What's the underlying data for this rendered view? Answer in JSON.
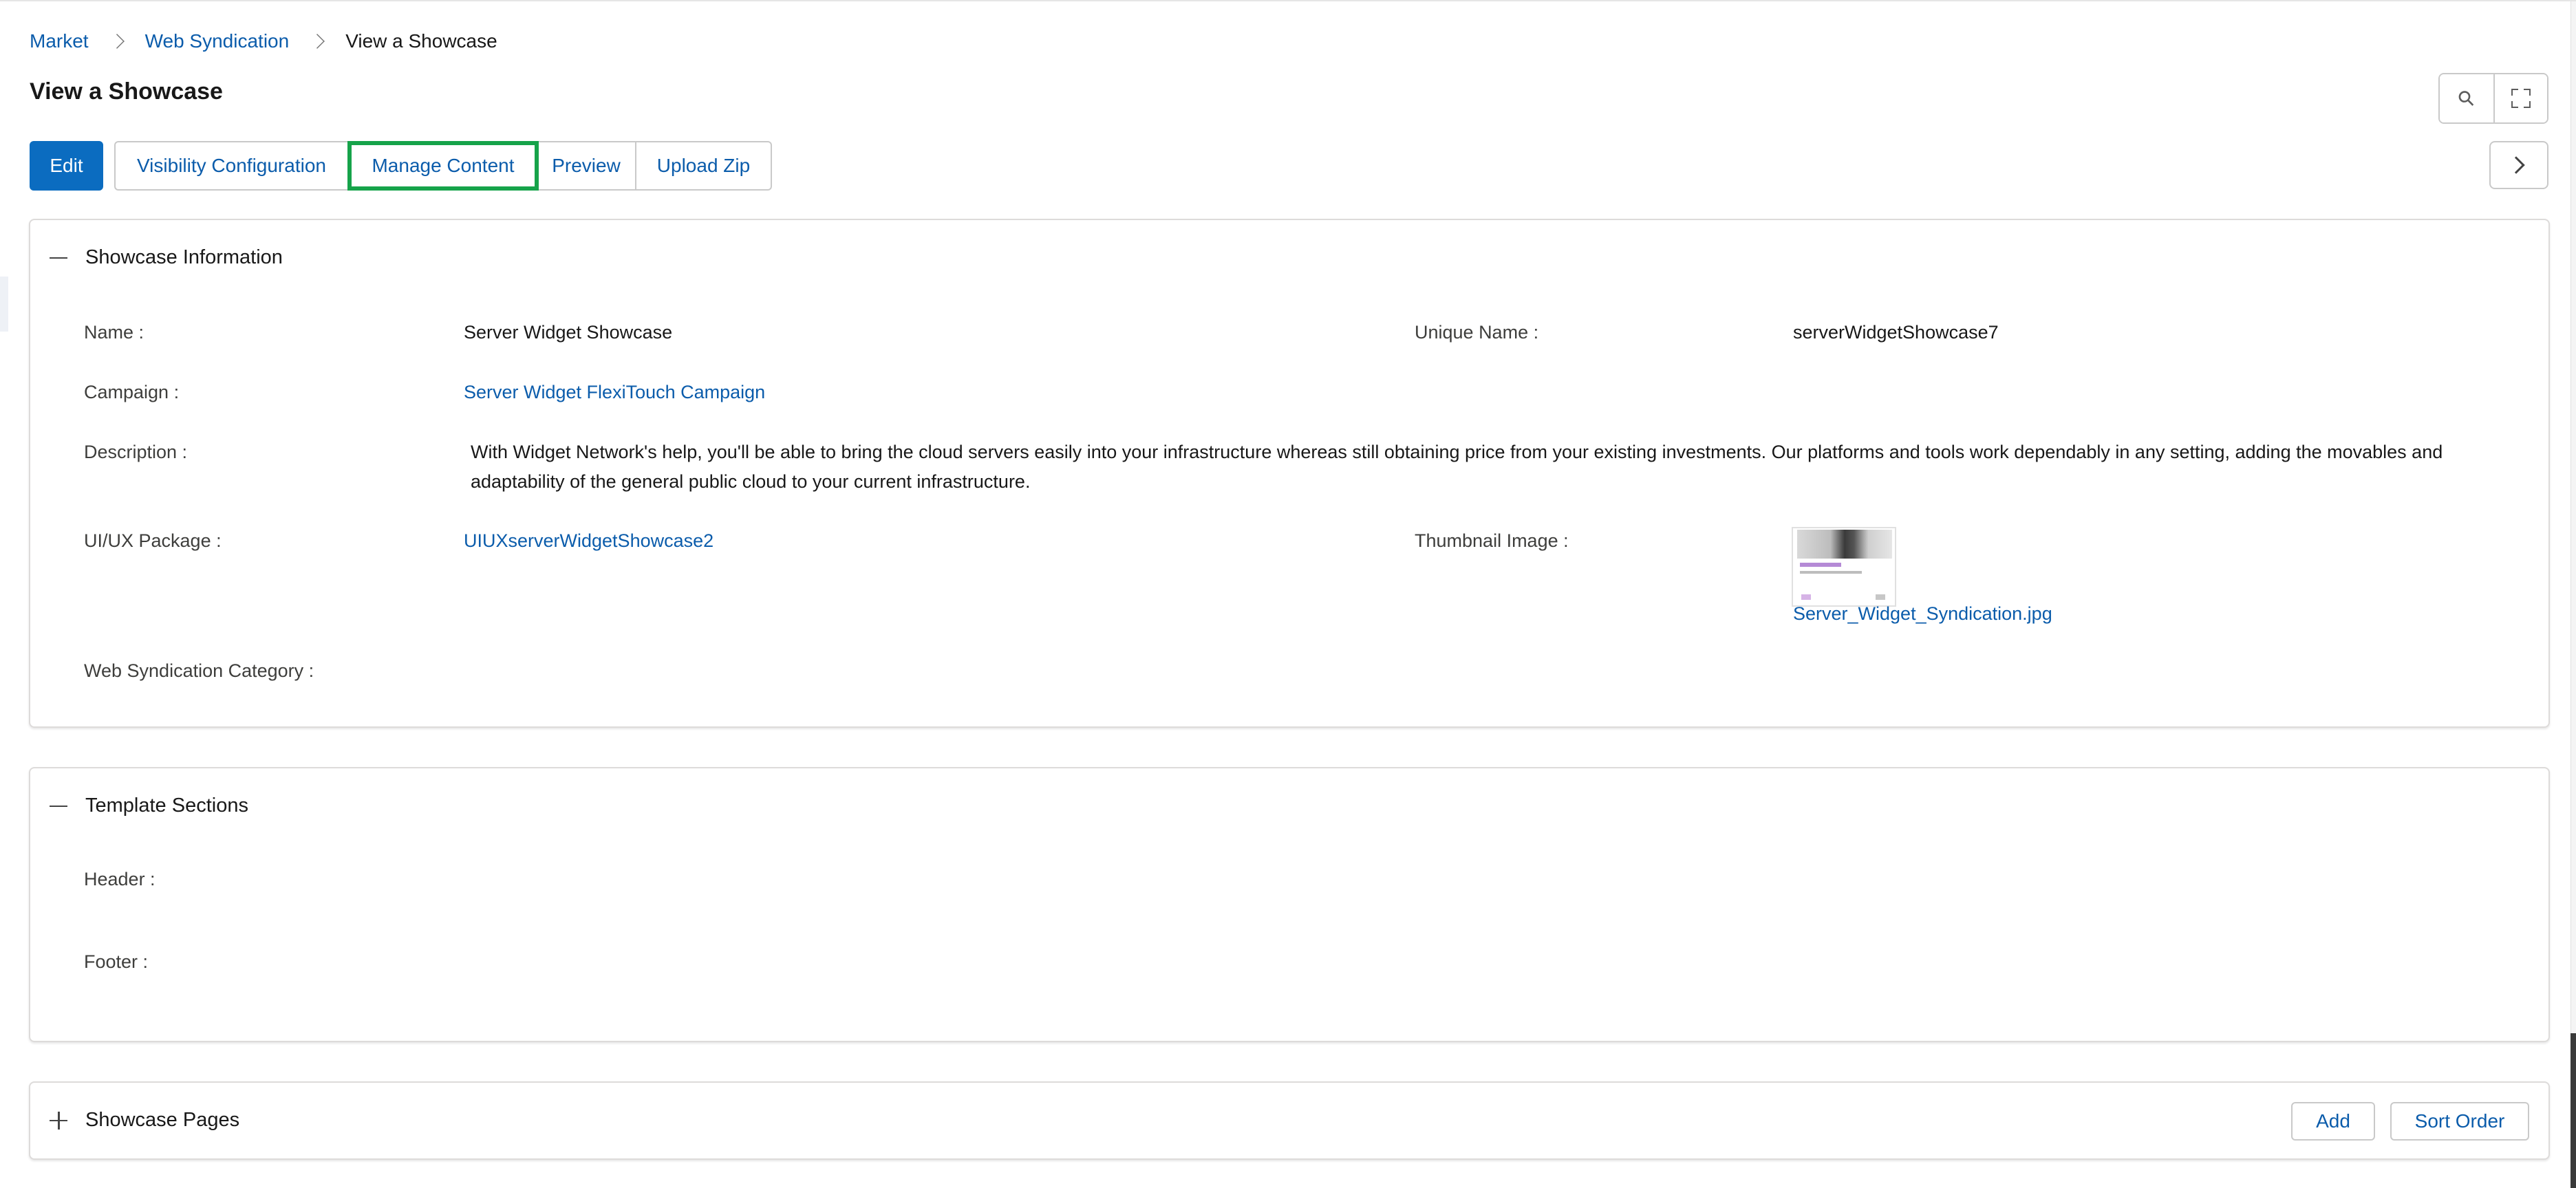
{
  "breadcrumb": {
    "items": [
      "Market",
      "Web Syndication"
    ],
    "current": "View a Showcase"
  },
  "page": {
    "title": "View a Showcase"
  },
  "toolbar": {
    "edit": "Edit",
    "visibility": "Visibility Configuration",
    "manage_content": "Manage Content",
    "preview": "Preview",
    "upload_zip": "Upload Zip"
  },
  "icons": {
    "pin": "pin-icon",
    "expand": "expand-icon",
    "chevron": "chevron-right-icon",
    "collapse": "minus-icon",
    "plus": "plus-icon"
  },
  "colors": {
    "brand": "#0b6cc0",
    "link": "#0b5cab",
    "highlight": "#16a34a"
  },
  "showcase_info": {
    "heading": "Showcase Information",
    "name_label": "Name :",
    "name_value": "Server Widget Showcase",
    "unique_name_label": "Unique Name :",
    "unique_name_value": "serverWidgetShowcase7",
    "campaign_label": "Campaign :",
    "campaign_value": "Server Widget FlexiTouch Campaign",
    "description_label": "Description :",
    "description_value": "With Widget Network's help, you'll be able to bring the cloud servers easily into your infrastructure whereas still obtaining price from your existing investments. Our platforms and tools work dependably in any setting, adding the movables and adaptability of the general public cloud to your current infrastructure.",
    "uiux_label": "UI/UX Package :",
    "uiux_value": "UIUXserverWidgetShowcase2",
    "thumbnail_label": "Thumbnail Image :",
    "thumbnail_file": "Server_Widget_Syndication.jpg",
    "category_label": "Web Syndication Category :"
  },
  "template_sections": {
    "heading": "Template Sections",
    "header_label": "Header :",
    "footer_label": "Footer :"
  },
  "showcase_pages": {
    "heading": "Showcase Pages",
    "add": "Add",
    "sort_order": "Sort Order"
  }
}
